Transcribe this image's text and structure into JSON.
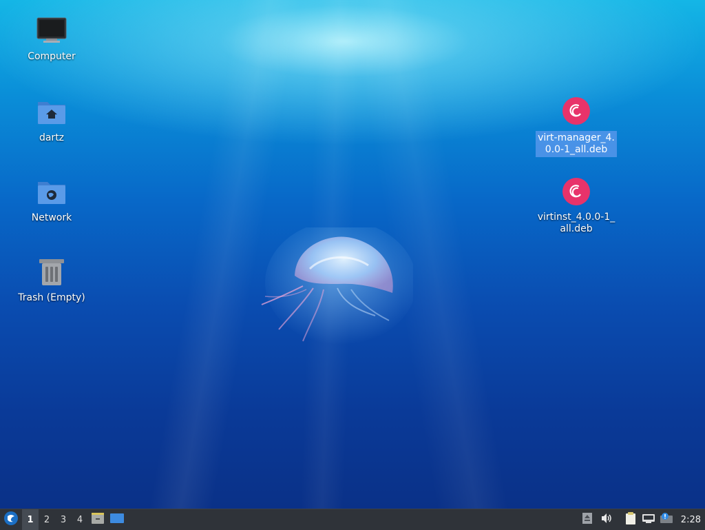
{
  "desktop": {
    "icons": [
      {
        "id": "computer",
        "label": "Computer",
        "icon": "monitor-icon"
      },
      {
        "id": "home",
        "label": "dartz",
        "icon": "home-folder-icon"
      },
      {
        "id": "network",
        "label": "Network",
        "icon": "network-folder-icon"
      },
      {
        "id": "trash",
        "label": "Trash (Empty)",
        "icon": "trash-icon"
      },
      {
        "id": "virt-manager-deb",
        "label": "virt-manager_4.0.0-1_all.deb",
        "icon": "debian-package-icon",
        "selected": true
      },
      {
        "id": "virtinst-deb",
        "label": "virtinst_4.0.0-1_all.deb",
        "icon": "debian-package-icon",
        "selected": false
      }
    ]
  },
  "taskbar": {
    "start_icon": "lxqt-menu-icon",
    "workspaces": [
      "1",
      "2",
      "3",
      "4"
    ],
    "active_workspace": "1",
    "quicklaunch": [
      "file-manager-icon",
      "show-desktop-icon"
    ],
    "tray": [
      "eject-icon",
      "volume-icon",
      "clipboard-icon",
      "network-wired-icon",
      "notification-icon"
    ],
    "clock": "2:28"
  },
  "colors": {
    "taskbar_bg": "#2f3339",
    "selection": "#5596eb",
    "debian_red": "#e8336a"
  }
}
